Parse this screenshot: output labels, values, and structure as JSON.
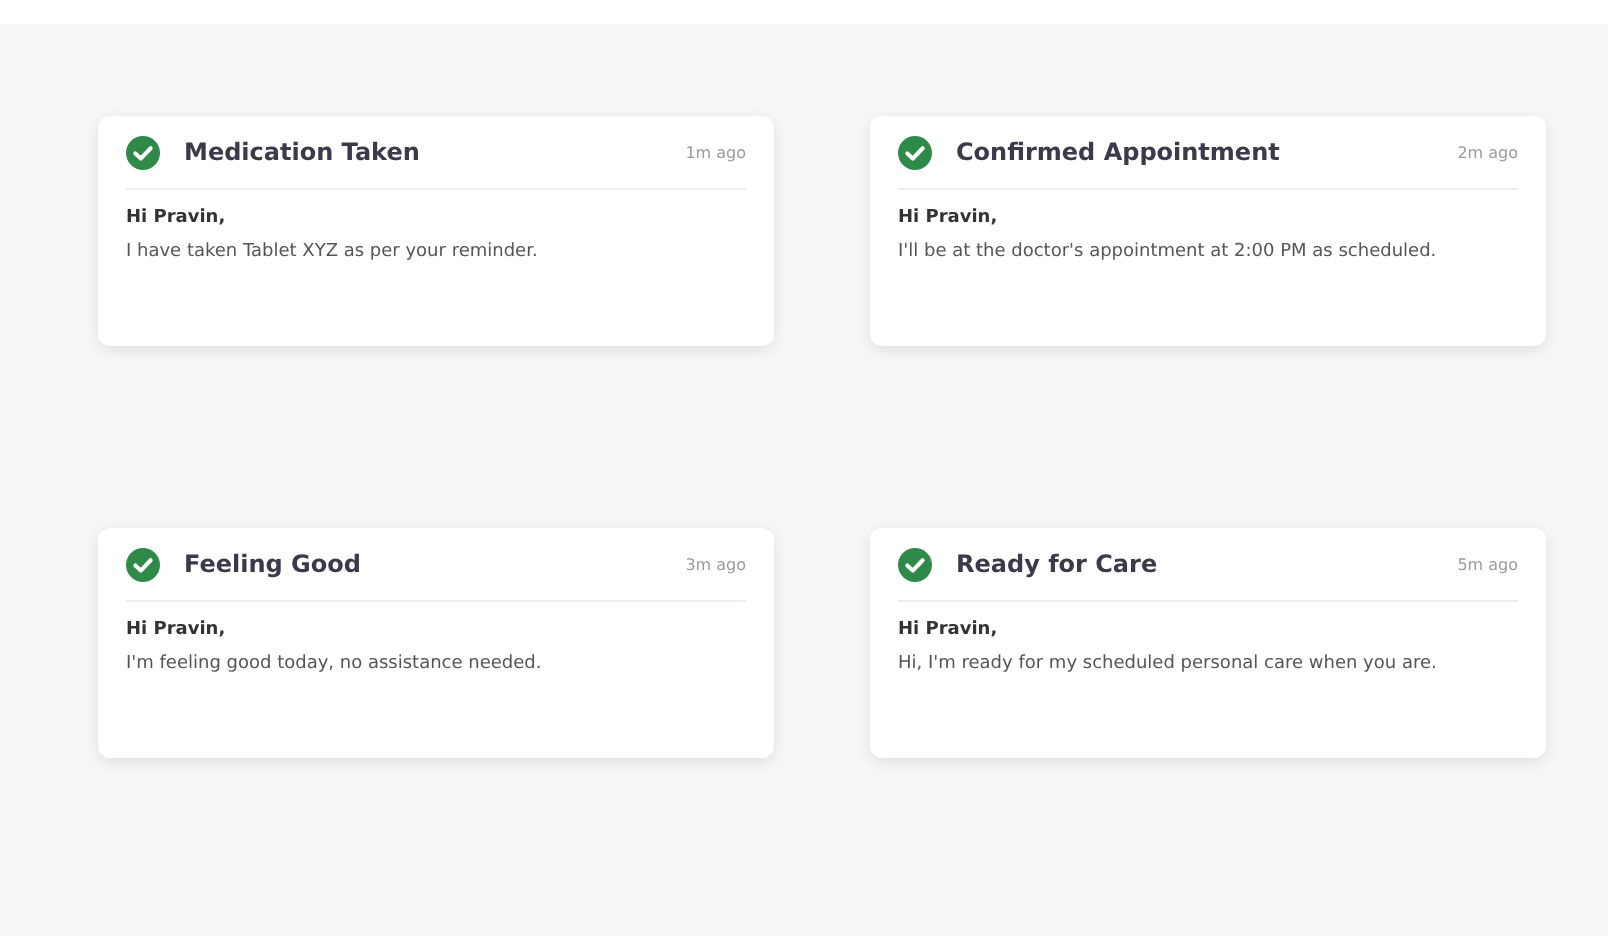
{
  "notifications": [
    {
      "title": "Medication Taken",
      "time": "1m ago",
      "greeting": "Hi Pravin,",
      "message": "I have taken Tablet XYZ as per your reminder."
    },
    {
      "title": "Confirmed Appointment",
      "time": "2m ago",
      "greeting": "Hi Pravin,",
      "message": "I'll be at the doctor's appointment at 2:00 PM as scheduled."
    },
    {
      "title": "Feeling Good",
      "time": "3m ago",
      "greeting": "Hi Pravin,",
      "message": "I'm feeling good today, no assistance needed."
    },
    {
      "title": "Ready for Care",
      "time": "5m ago",
      "greeting": "Hi Pravin,",
      "message": "Hi, I'm ready for my scheduled personal care when you are."
    }
  ]
}
